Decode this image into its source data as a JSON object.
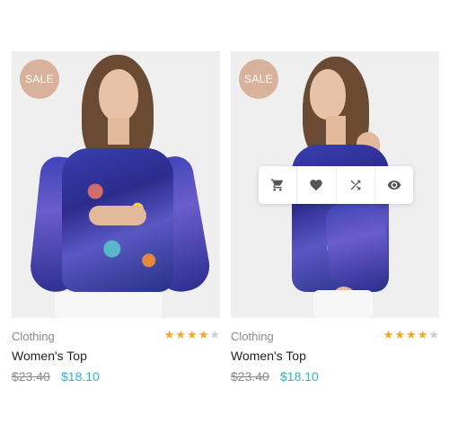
{
  "products": [
    {
      "badge": "SALE",
      "category": "Clothing",
      "name": "Women's Top",
      "price_old": "$23.40",
      "price_new": "$18.10",
      "rating": 4,
      "rating_max": 5,
      "quick_actions_visible": false
    },
    {
      "badge": "SALE",
      "category": "Clothing",
      "name": "Women's Top",
      "price_old": "$23.40",
      "price_new": "$18.10",
      "rating": 4,
      "rating_max": 5,
      "quick_actions_visible": true,
      "quick_actions": [
        {
          "icon": "cart-icon"
        },
        {
          "icon": "heart-icon"
        },
        {
          "icon": "shuffle-icon"
        },
        {
          "icon": "eye-icon"
        }
      ]
    }
  ],
  "colors": {
    "badge": "#d8b29a",
    "star_on": "#f5a623",
    "star_off": "#cfcfcf",
    "price_new": "#27b5d6"
  }
}
